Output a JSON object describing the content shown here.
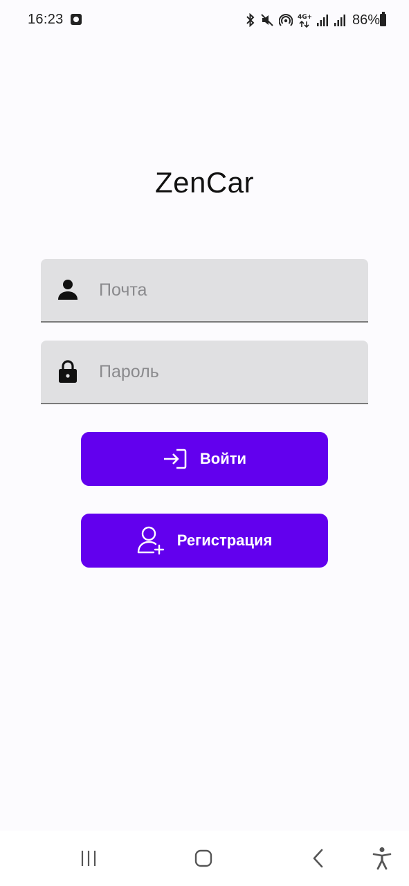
{
  "status_bar": {
    "time": "16:23",
    "battery": "86%",
    "network": "4G+",
    "icons": [
      "bluetooth-icon",
      "mute-icon",
      "hotspot-icon",
      "network-4g-icon",
      "signal-icon",
      "signal-icon",
      "battery-icon"
    ]
  },
  "app": {
    "title": "ZenCar"
  },
  "form": {
    "email": {
      "placeholder": "Почта",
      "value": "",
      "icon": "person-icon"
    },
    "password": {
      "placeholder": "Пароль",
      "value": "",
      "icon": "lock-icon"
    }
  },
  "buttons": {
    "login": {
      "label": "Войти",
      "icon": "login-icon"
    },
    "register": {
      "label": "Регистрация",
      "icon": "person-add-icon"
    }
  },
  "nav_bar": {
    "items": [
      "recents-icon",
      "home-icon",
      "back-icon",
      "accessibility-icon"
    ]
  },
  "colors": {
    "accent": "#6200ee",
    "field_bg": "#e0e0e2",
    "background": "#fcfbfe"
  }
}
